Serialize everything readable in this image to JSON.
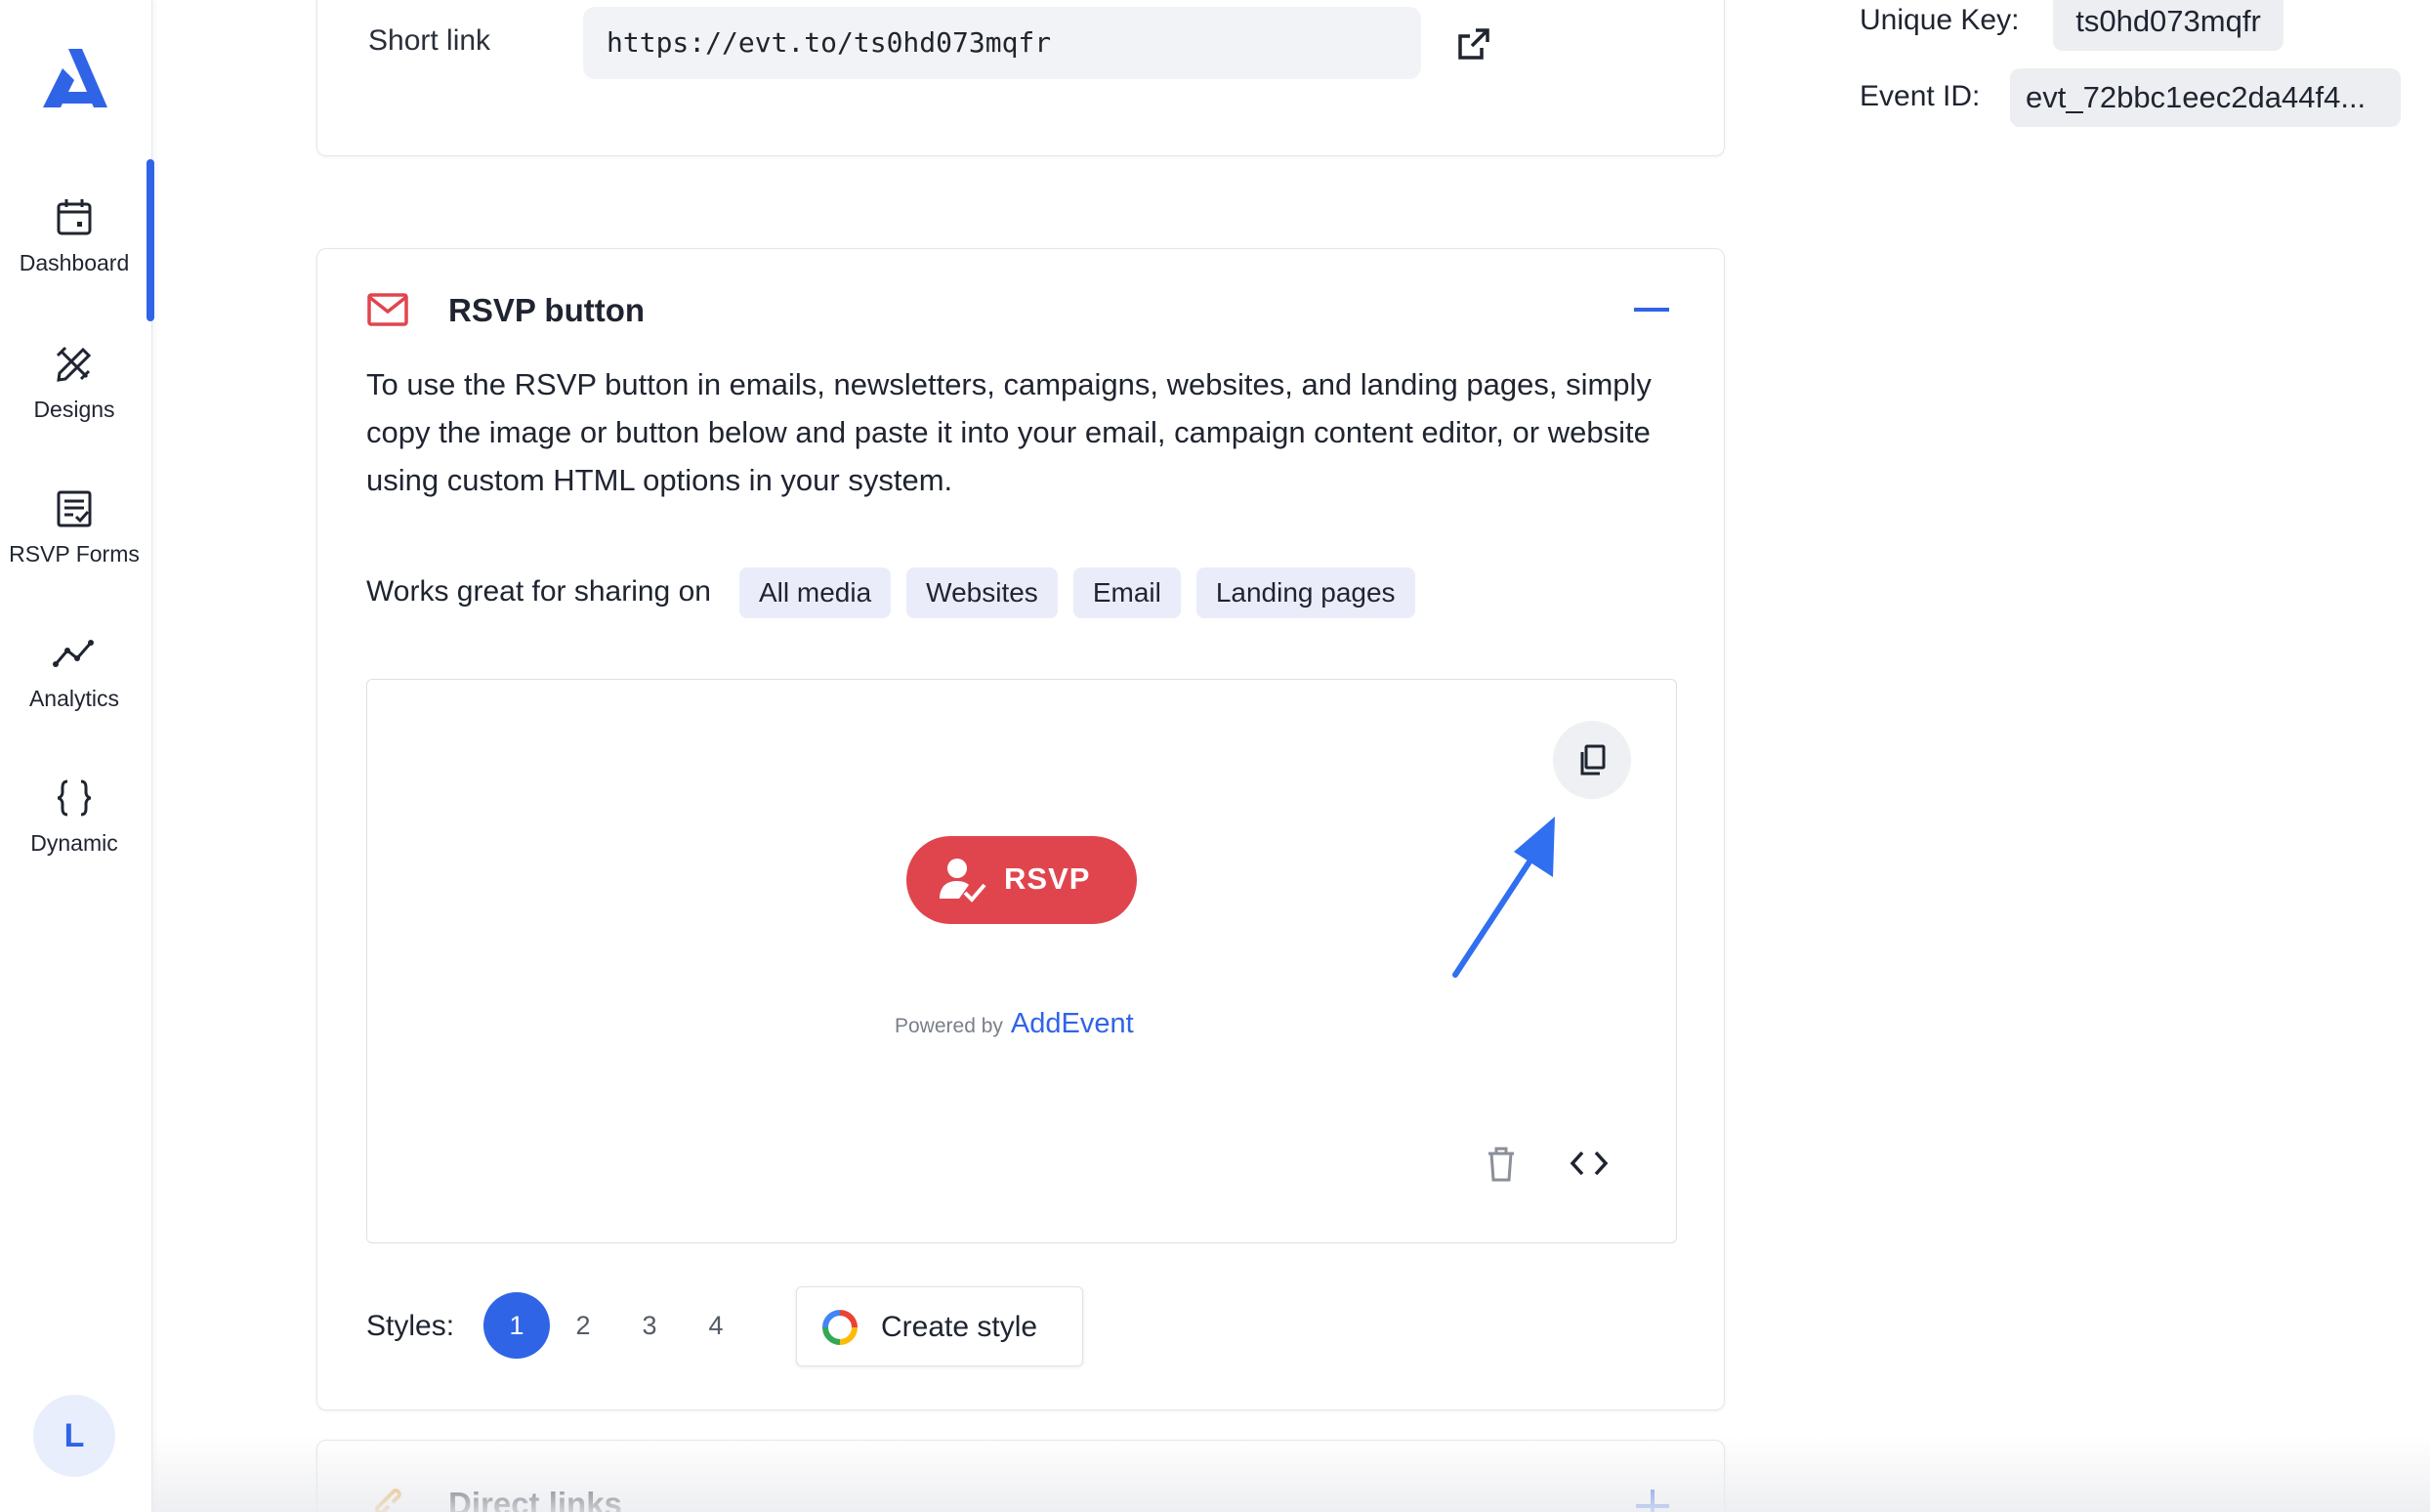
{
  "sidebar": {
    "logo": "addevent-logo",
    "items": [
      {
        "label": "Dashboard",
        "icon": "calendar-icon"
      },
      {
        "label": "Designs",
        "icon": "pencil-ruler-icon"
      },
      {
        "label": "RSVP Forms",
        "icon": "form-check-icon"
      },
      {
        "label": "Analytics",
        "icon": "trend-line-icon"
      },
      {
        "label": "Dynamic",
        "icon": "curly-braces-icon"
      }
    ],
    "active_item": "Dashboard",
    "avatar_initial": "L"
  },
  "meta": {
    "unique_key_label": "Unique Key:",
    "unique_key_value": "ts0hd073mqfr",
    "event_id_label": "Event ID:",
    "event_id_value": "evt_72bbc1eec2da44f4..."
  },
  "short_link": {
    "label": "Short link",
    "value": "https://evt.to/ts0hd073mqfr"
  },
  "rsvp_card": {
    "title": "RSVP button",
    "description": "To use the RSVP button in emails, newsletters, campaigns, websites, and landing pages, simply copy the image or button below and paste it into your email, campaign content editor, or website using custom HTML options in your system.",
    "share_label": "Works great for sharing on",
    "tags": [
      "All media",
      "Websites",
      "Email",
      "Landing pages"
    ],
    "preview": {
      "button_label": "RSVP",
      "powered_by": "Powered by",
      "brand": "AddEvent"
    },
    "styles_label": "Styles:",
    "styles": [
      "1",
      "2",
      "3",
      "4"
    ],
    "active_style": "1",
    "create_style_label": "Create style"
  },
  "direct_links": {
    "title": "Direct links"
  },
  "colors": {
    "accent": "#2f64e6",
    "rsvp_red": "#e0454e",
    "tag_bg": "#eaedf9"
  }
}
